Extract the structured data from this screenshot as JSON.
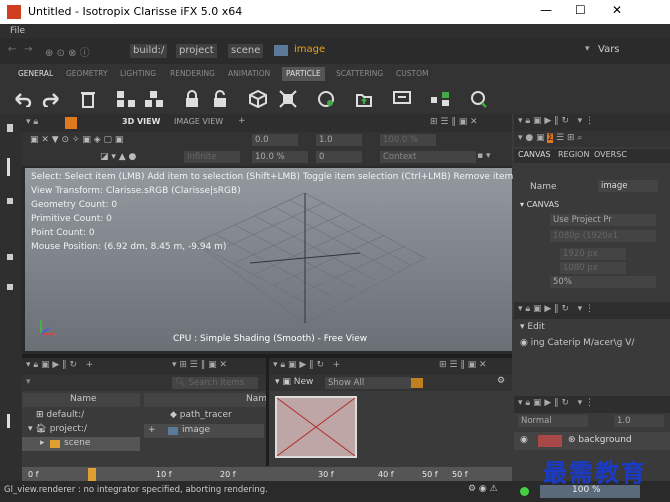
{
  "window": {
    "title": "Untitled - Isotropix Clarisse iFX 5.0 x64"
  },
  "menu": {
    "file": "File"
  },
  "address": {
    "crumbs": [
      "build:/",
      "project",
      "scene",
      "image"
    ],
    "vars": "Vars"
  },
  "tabs": [
    "GENERAL",
    "GEOMETRY",
    "LIGHTING",
    "RENDERING",
    "ANIMATION",
    "PARTICLE",
    "SCATTERING",
    "CUSTOM"
  ],
  "viewport": {
    "tabs": [
      "3D VIEW",
      "IMAGE VIEW"
    ],
    "toolbar_values": [
      "0.0",
      "1.0",
      "100.0 %"
    ],
    "toolbar2": {
      "infinite": "Infinite",
      "percent": "10.0 %",
      "zero": "0",
      "context": "Context"
    },
    "info_lines": [
      "Select: Select item (LMB)  Add item to selection (Shift+LMB)  Toggle item selection (Ctrl+LMB)  Remove item fro",
      "View Transform: Clarisse.sRGB (Clarisse|sRGB)",
      "Geometry Count: 0",
      "Primitive Count: 0",
      "Point Count: 0",
      "Mouse Position: (6.92 dm, 8.45 m, -9.94 m)"
    ],
    "shading": "CPU : Simple Shading (Smooth) - Free View"
  },
  "browser": {
    "search": "Search Items",
    "col_name": "Name",
    "col_nam2": "Nam",
    "tree": [
      "default:/",
      "project:/",
      "scene"
    ],
    "items": [
      "path_tracer",
      "image"
    ]
  },
  "image_panel": {
    "new": "New",
    "show_all": "Show All"
  },
  "right": {
    "tabs": [
      "CANVAS",
      "REGION",
      "OVERSC"
    ],
    "name_label": "Name",
    "name_value": "image",
    "canvas": "CANVAS",
    "use_project": "Use Project Pr",
    "res": "1080p (1920x1",
    "w": "1920 px",
    "h": "1080 px",
    "pct": "50%",
    "edit": "Edit",
    "layers": "ing Caterip M/acer\\g V/",
    "blend": "Normal",
    "blend_val": "1.0",
    "bg": "background"
  },
  "timeline": {
    "ticks": [
      "0 f",
      "10 f",
      "20 f",
      "30 f",
      "40 f",
      "50 f",
      "50 f"
    ]
  },
  "status": {
    "text": "Gl_view.renderer : no integrator specified, aborting rendering.",
    "zoom": "100 %"
  },
  "watermark": "最需教育"
}
